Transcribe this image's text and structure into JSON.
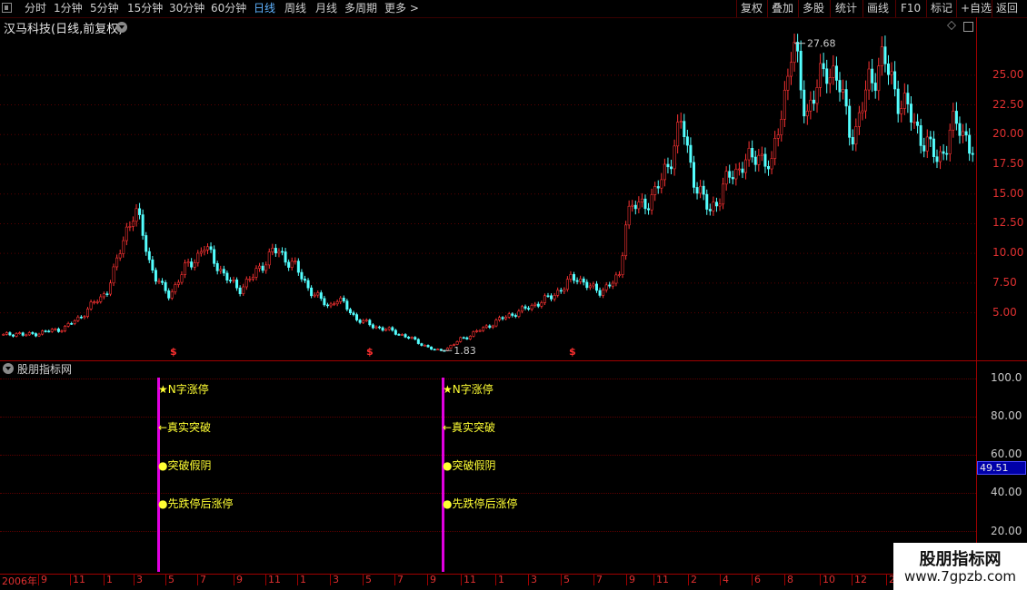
{
  "toolbar": {
    "periods": [
      "分时",
      "1分钟",
      "5分钟",
      "15分钟",
      "30分钟",
      "60分钟",
      "日线",
      "周线",
      "月线",
      "多周期",
      "更多 >"
    ],
    "active_period": "日线",
    "actions": [
      "复权",
      "叠加",
      "多股",
      "统计",
      "画线",
      "F10",
      "标记",
      "+自选",
      "返回"
    ]
  },
  "price_panel": {
    "title": "汉马科技(日线,前复权)",
    "high_label": "27.68",
    "low_label": "1.83",
    "y_ticks": [
      "25.00",
      "22.50",
      "20.00",
      "17.50",
      "15.00",
      "12.50",
      "10.00",
      "7.50",
      "5.00"
    ],
    "dollar_marker": "$"
  },
  "indicator_panel": {
    "title": "股朋指标网",
    "y_ticks": [
      "100.0",
      "80.00",
      "60.00",
      "40.00",
      "20.00"
    ],
    "current_value": "49.51",
    "signal_labels": [
      "★N字涨停",
      "←真实突破",
      "●突破假阴",
      "●先跌停后涨停"
    ]
  },
  "x_axis": {
    "labels": [
      "2006年",
      "9",
      "11",
      "1",
      "3",
      "5",
      "7",
      "9",
      "11",
      "1",
      "3",
      "5",
      "7",
      "9",
      "11",
      "1",
      "3",
      "5",
      "7",
      "9",
      "11",
      "2",
      "4",
      "6",
      "8",
      "10",
      "12",
      "2"
    ]
  },
  "watermark": {
    "title": "股朋指标网",
    "url": "www.7gpzb.com"
  },
  "colors": {
    "up": "#ff3333",
    "down": "#54ffff",
    "grid": "#5a0000",
    "signal_bar": "#e000e0",
    "signal_text": "#ffff33",
    "active_tab": "#5fb3ff"
  },
  "chart_data": {
    "type": "candlestick",
    "y_range": [
      1.0,
      28.5
    ],
    "y_ticks": [
      5.0,
      7.5,
      10.0,
      12.5,
      15.0,
      17.5,
      20.0,
      22.5,
      25.0
    ],
    "close_series": [
      3.1,
      3.2,
      3.3,
      3.1,
      3.2,
      3.3,
      3.4,
      3.5,
      3.6,
      3.8,
      4.2,
      4.6,
      5.2,
      5.8,
      6.2,
      7.0,
      8.5,
      10.5,
      12.5,
      13.5,
      12.0,
      9.5,
      8.0,
      7.0,
      6.5,
      7.5,
      8.5,
      9.2,
      9.8,
      10.5,
      9.8,
      9.0,
      8.0,
      7.5,
      7.0,
      7.5,
      8.0,
      8.8,
      9.5,
      10.2,
      10.0,
      9.5,
      9.0,
      8.0,
      7.2,
      6.5,
      6.0,
      5.5,
      6.2,
      5.8,
      5.2,
      4.5,
      4.2,
      4.0,
      3.8,
      3.6,
      3.5,
      3.3,
      3.0,
      2.8,
      2.5,
      2.2,
      1.9,
      1.83,
      2.0,
      2.3,
      2.8,
      3.0,
      3.3,
      3.6,
      3.9,
      4.2,
      4.5,
      4.8,
      5.0,
      5.2,
      5.5,
      5.8,
      6.0,
      6.3,
      6.8,
      7.2,
      7.8,
      8.0,
      7.5,
      7.0,
      6.8,
      7.2,
      7.5,
      8.0,
      13.5,
      14.0,
      13.8,
      14.5,
      15.0,
      16.0,
      17.5,
      19.5,
      21.0,
      18.0,
      16.0,
      14.5,
      13.5,
      14.5,
      15.5,
      16.5,
      17.0,
      18.0,
      17.5,
      18.5,
      18.0,
      17.0,
      21.0,
      24.0,
      27.68,
      24.5,
      22.0,
      23.0,
      24.5,
      26.0,
      25.0,
      23.5,
      21.0,
      20.0,
      22.0,
      24.5,
      25.5,
      26.2,
      25.0,
      23.5,
      22.5,
      21.5,
      20.5,
      19.5,
      18.5,
      18.0,
      19.0,
      20.5,
      20.8,
      20.0,
      18.5
    ],
    "high_marker": 27.68,
    "low_marker": 1.83,
    "signal_markers": "$"
  }
}
